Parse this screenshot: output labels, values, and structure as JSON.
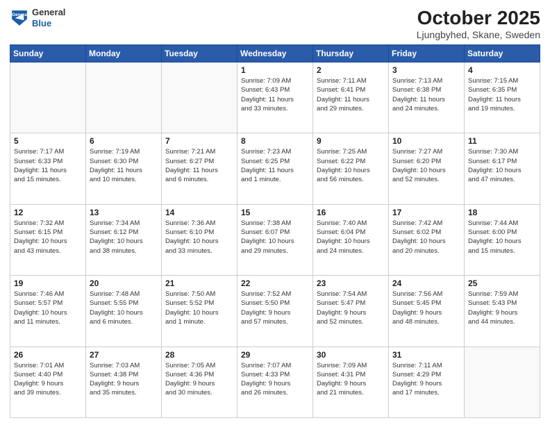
{
  "header": {
    "logo_line1": "General",
    "logo_line2": "Blue",
    "title": "October 2025",
    "subtitle": "Ljungbyhed, Skane, Sweden"
  },
  "weekdays": [
    "Sunday",
    "Monday",
    "Tuesday",
    "Wednesday",
    "Thursday",
    "Friday",
    "Saturday"
  ],
  "weeks": [
    [
      {
        "day": "",
        "info": ""
      },
      {
        "day": "",
        "info": ""
      },
      {
        "day": "",
        "info": ""
      },
      {
        "day": "1",
        "info": "Sunrise: 7:09 AM\nSunset: 6:43 PM\nDaylight: 11 hours\nand 33 minutes."
      },
      {
        "day": "2",
        "info": "Sunrise: 7:11 AM\nSunset: 6:41 PM\nDaylight: 11 hours\nand 29 minutes."
      },
      {
        "day": "3",
        "info": "Sunrise: 7:13 AM\nSunset: 6:38 PM\nDaylight: 11 hours\nand 24 minutes."
      },
      {
        "day": "4",
        "info": "Sunrise: 7:15 AM\nSunset: 6:35 PM\nDaylight: 11 hours\nand 19 minutes."
      }
    ],
    [
      {
        "day": "5",
        "info": "Sunrise: 7:17 AM\nSunset: 6:33 PM\nDaylight: 11 hours\nand 15 minutes."
      },
      {
        "day": "6",
        "info": "Sunrise: 7:19 AM\nSunset: 6:30 PM\nDaylight: 11 hours\nand 10 minutes."
      },
      {
        "day": "7",
        "info": "Sunrise: 7:21 AM\nSunset: 6:27 PM\nDaylight: 11 hours\nand 6 minutes."
      },
      {
        "day": "8",
        "info": "Sunrise: 7:23 AM\nSunset: 6:25 PM\nDaylight: 11 hours\nand 1 minute."
      },
      {
        "day": "9",
        "info": "Sunrise: 7:25 AM\nSunset: 6:22 PM\nDaylight: 10 hours\nand 56 minutes."
      },
      {
        "day": "10",
        "info": "Sunrise: 7:27 AM\nSunset: 6:20 PM\nDaylight: 10 hours\nand 52 minutes."
      },
      {
        "day": "11",
        "info": "Sunrise: 7:30 AM\nSunset: 6:17 PM\nDaylight: 10 hours\nand 47 minutes."
      }
    ],
    [
      {
        "day": "12",
        "info": "Sunrise: 7:32 AM\nSunset: 6:15 PM\nDaylight: 10 hours\nand 43 minutes."
      },
      {
        "day": "13",
        "info": "Sunrise: 7:34 AM\nSunset: 6:12 PM\nDaylight: 10 hours\nand 38 minutes."
      },
      {
        "day": "14",
        "info": "Sunrise: 7:36 AM\nSunset: 6:10 PM\nDaylight: 10 hours\nand 33 minutes."
      },
      {
        "day": "15",
        "info": "Sunrise: 7:38 AM\nSunset: 6:07 PM\nDaylight: 10 hours\nand 29 minutes."
      },
      {
        "day": "16",
        "info": "Sunrise: 7:40 AM\nSunset: 6:04 PM\nDaylight: 10 hours\nand 24 minutes."
      },
      {
        "day": "17",
        "info": "Sunrise: 7:42 AM\nSunset: 6:02 PM\nDaylight: 10 hours\nand 20 minutes."
      },
      {
        "day": "18",
        "info": "Sunrise: 7:44 AM\nSunset: 6:00 PM\nDaylight: 10 hours\nand 15 minutes."
      }
    ],
    [
      {
        "day": "19",
        "info": "Sunrise: 7:46 AM\nSunset: 5:57 PM\nDaylight: 10 hours\nand 11 minutes."
      },
      {
        "day": "20",
        "info": "Sunrise: 7:48 AM\nSunset: 5:55 PM\nDaylight: 10 hours\nand 6 minutes."
      },
      {
        "day": "21",
        "info": "Sunrise: 7:50 AM\nSunset: 5:52 PM\nDaylight: 10 hours\nand 1 minute."
      },
      {
        "day": "22",
        "info": "Sunrise: 7:52 AM\nSunset: 5:50 PM\nDaylight: 9 hours\nand 57 minutes."
      },
      {
        "day": "23",
        "info": "Sunrise: 7:54 AM\nSunset: 5:47 PM\nDaylight: 9 hours\nand 52 minutes."
      },
      {
        "day": "24",
        "info": "Sunrise: 7:56 AM\nSunset: 5:45 PM\nDaylight: 9 hours\nand 48 minutes."
      },
      {
        "day": "25",
        "info": "Sunrise: 7:59 AM\nSunset: 5:43 PM\nDaylight: 9 hours\nand 44 minutes."
      }
    ],
    [
      {
        "day": "26",
        "info": "Sunrise: 7:01 AM\nSunset: 4:40 PM\nDaylight: 9 hours\nand 39 minutes."
      },
      {
        "day": "27",
        "info": "Sunrise: 7:03 AM\nSunset: 4:38 PM\nDaylight: 9 hours\nand 35 minutes."
      },
      {
        "day": "28",
        "info": "Sunrise: 7:05 AM\nSunset: 4:36 PM\nDaylight: 9 hours\nand 30 minutes."
      },
      {
        "day": "29",
        "info": "Sunrise: 7:07 AM\nSunset: 4:33 PM\nDaylight: 9 hours\nand 26 minutes."
      },
      {
        "day": "30",
        "info": "Sunrise: 7:09 AM\nSunset: 4:31 PM\nDaylight: 9 hours\nand 21 minutes."
      },
      {
        "day": "31",
        "info": "Sunrise: 7:11 AM\nSunset: 4:29 PM\nDaylight: 9 hours\nand 17 minutes."
      },
      {
        "day": "",
        "info": ""
      }
    ]
  ]
}
